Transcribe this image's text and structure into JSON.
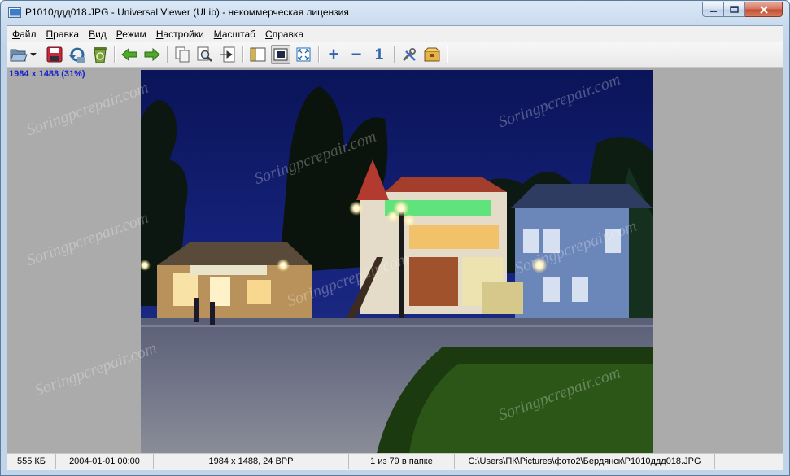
{
  "window": {
    "title": "P1010ддд018.JPG - Universal Viewer (ULib) - некоммерческая лицензия"
  },
  "menu": {
    "items": [
      {
        "label": "Файл"
      },
      {
        "label": "Правка"
      },
      {
        "label": "Вид"
      },
      {
        "label": "Режим"
      },
      {
        "label": "Настройки"
      },
      {
        "label": "Масштаб"
      },
      {
        "label": "Справка"
      }
    ]
  },
  "toolbar": {
    "buttons": [
      {
        "icon": "open-folder-icon"
      },
      {
        "icon": "dropdown-arrow-icon"
      },
      {
        "icon": "save-icon"
      },
      {
        "icon": "reload-icon"
      },
      {
        "icon": "recycle-bin-icon"
      },
      {
        "icon": "prev-arrow-icon"
      },
      {
        "icon": "next-arrow-icon"
      },
      {
        "icon": "copy-icon"
      },
      {
        "icon": "find-icon"
      },
      {
        "icon": "goto-icon"
      },
      {
        "icon": "panel-icon"
      },
      {
        "icon": "fit-window-icon"
      },
      {
        "icon": "fullscreen-icon"
      },
      {
        "icon": "zoom-in-icon"
      },
      {
        "icon": "zoom-out-icon"
      },
      {
        "icon": "actual-size-icon"
      },
      {
        "icon": "settings-tools-icon"
      },
      {
        "icon": "plugins-box-icon"
      }
    ],
    "zoom_in_symbol": "+",
    "zoom_out_symbol": "−",
    "actual_size_symbol": "1"
  },
  "viewer": {
    "image_dimensions": "1984 x 1488 (31%)",
    "watermark_text": "Soringpcrepair.com"
  },
  "statusbar": {
    "file_size": "555 КБ",
    "date": "2004-01-01 00:00",
    "image_info": "1984 x 1488, 24 BPP",
    "position": "1 из 79 в папке",
    "path": "C:\\Users\\ПК\\Pictures\\фото2\\Бердянск\\P1010ддд018.JPG"
  },
  "colors": {
    "dims_label": "#1a22c8",
    "viewer_bg": "#ababab",
    "sky": "#0c1a6e"
  }
}
